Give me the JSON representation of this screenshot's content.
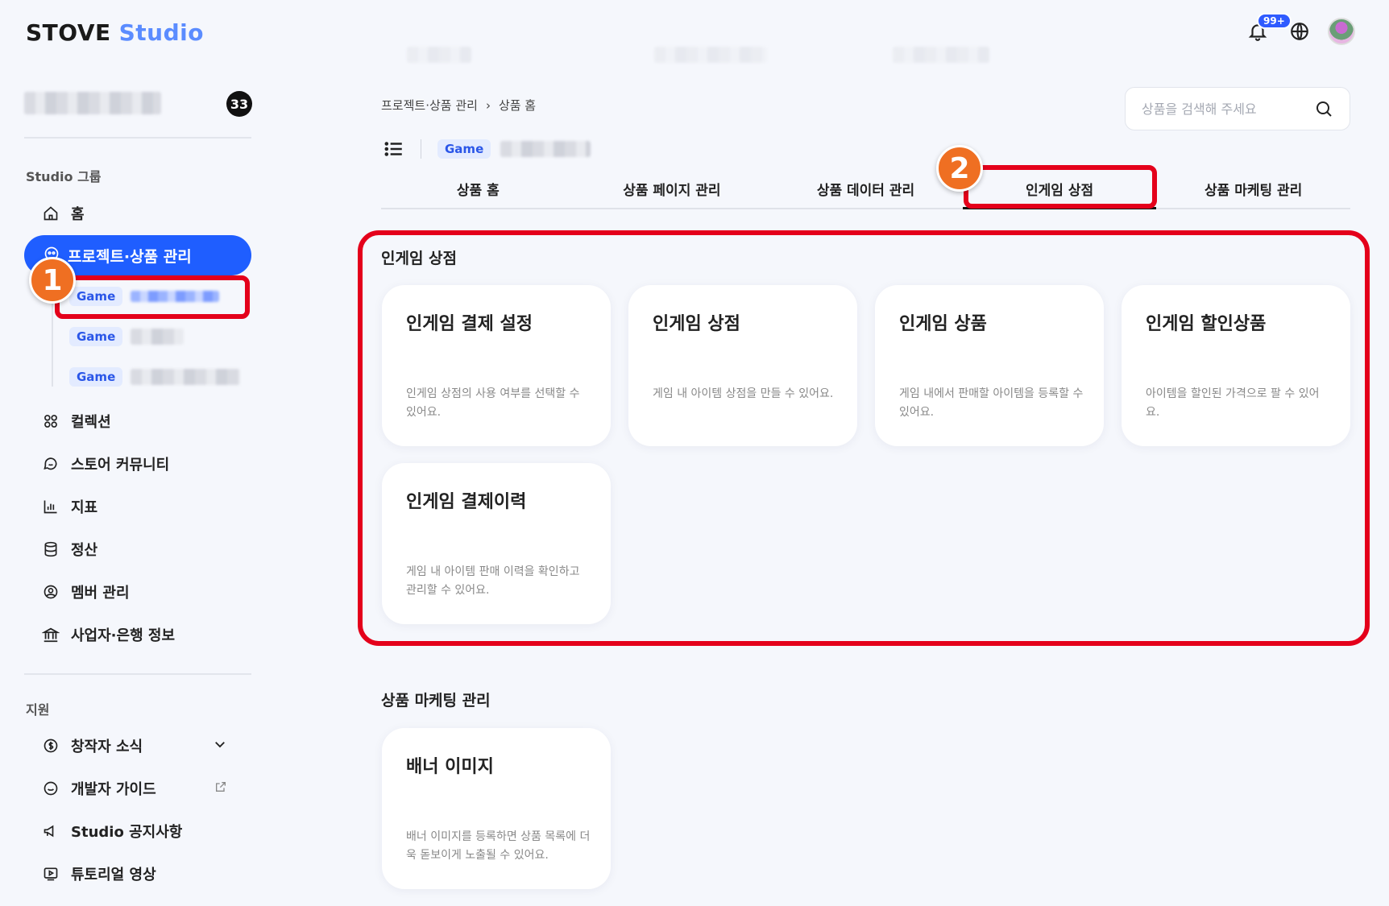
{
  "brand": {
    "name": "STOVE",
    "product": "Studio"
  },
  "header": {
    "notification_count": "99+"
  },
  "sidebar": {
    "count_badge": "33",
    "group_label": "Studio 그룹",
    "items": {
      "home": "홈",
      "project": "프로젝트·상품 관리",
      "collection": "컬렉션",
      "community": "스토어 커뮤니티",
      "metrics": "지표",
      "settlement": "정산",
      "members": "멤버 관리",
      "business": "사업자·은행 정보"
    },
    "game_tag": "Game",
    "support_label": "지원",
    "support": {
      "news": "창작자 소식",
      "guide": "개발자 가이드",
      "notice": "Studio 공지사항",
      "tutorial": "튜토리얼 영상"
    }
  },
  "main": {
    "breadcrumb": [
      "프로젝트·상품 관리",
      "상품 홈"
    ],
    "search_placeholder": "상품을 검색해 주세요",
    "game_tag": "Game",
    "tabs": [
      "상품 홈",
      "상품 페이지 관리",
      "상품 데이터 관리",
      "인게임 상점",
      "상품 마케팅 관리"
    ],
    "active_tab": 3,
    "sections": [
      {
        "title": "인게임 상점",
        "cards": [
          {
            "title": "인게임 결제 설정",
            "desc": "인게임 상점의 사용 여부를 선택할 수 있어요."
          },
          {
            "title": "인게임 상점",
            "desc": "게임 내 아이템 상점을 만들 수 있어요."
          },
          {
            "title": "인게임 상품",
            "desc": "게임 내에서 판매할 아이템을 등록할 수 있어요."
          },
          {
            "title": "인게임 할인상품",
            "desc": "아이템을 할인된 가격으로 팔 수 있어요."
          },
          {
            "title": "인게임 결제이력",
            "desc": "게임 내 아이템 판매 이력을 확인하고 관리할 수 있어요."
          }
        ]
      },
      {
        "title": "상품 마케팅 관리",
        "cards": [
          {
            "title": "배너 이미지",
            "desc": "배너 이미지를 등록하면 상품 목록에 더욱 돋보이게 노출될 수 있어요."
          }
        ]
      }
    ]
  },
  "annotations": {
    "step1": "1",
    "step2": "2"
  },
  "colors": {
    "accent": "#1f5eff",
    "highlight": "#e4001b",
    "step": "#ef6f22"
  }
}
